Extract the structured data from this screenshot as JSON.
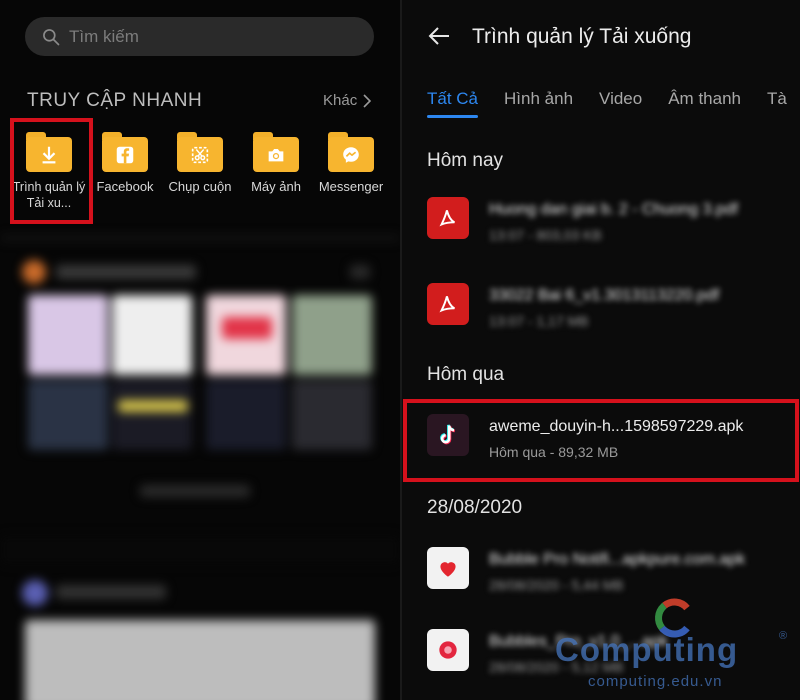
{
  "left": {
    "search": {
      "placeholder": "Tìm kiếm",
      "icon": "search-icon"
    },
    "quick_access": {
      "title": "TRUY CẬP NHANH",
      "more_label": "Khác",
      "items": [
        {
          "label": "Trình quản lý Tải xu...",
          "icon": "download-icon",
          "highlighted": true
        },
        {
          "label": "Facebook",
          "icon": "facebook-icon"
        },
        {
          "label": "Chụp cuộn",
          "icon": "scroll-screenshot-icon"
        },
        {
          "label": "Máy ảnh",
          "icon": "camera-icon"
        },
        {
          "label": "Messenger",
          "icon": "messenger-icon"
        }
      ],
      "folder_color": "#f7b52f"
    }
  },
  "right": {
    "title": "Trình quản lý Tải xuống",
    "tabs": [
      {
        "label": "Tất Cả",
        "active": true
      },
      {
        "label": "Hình ảnh"
      },
      {
        "label": "Video"
      },
      {
        "label": "Âm thanh"
      },
      {
        "label": "Tà"
      }
    ],
    "sections": [
      {
        "title": "Hôm nay",
        "files": [
          {
            "name": "Huong dan giai b. 2 - Chuong 3.pdf",
            "meta": "13:07 - 803,03 KB",
            "icon": "pdf-icon",
            "blurred": true
          },
          {
            "name": "33022 Bai 6_v1.3013113220.pdf",
            "meta": "13:07 - 1,17 MB",
            "icon": "pdf-icon",
            "blurred": true
          }
        ]
      },
      {
        "title": "Hôm qua",
        "files": [
          {
            "name": "aweme_douyin-h...1598597229.apk",
            "meta": "Hôm qua - 89,32 MB",
            "icon": "tiktok-icon",
            "highlighted": true
          }
        ]
      },
      {
        "title": "28/08/2020",
        "files": [
          {
            "name": "Bubble Pro Notifi...apkpure.com.apk",
            "meta": "28/08/2020 - 5,44 MB",
            "icon": "app-icon",
            "blurred": true
          },
          {
            "name": "Bubbles_Pro_v1.0_...apk",
            "meta": "28/08/2020 - 5,12 MB",
            "icon": "app-icon",
            "blurred": true
          }
        ]
      }
    ],
    "accent_color": "#2d87f0",
    "highlight_color": "#d5111c"
  },
  "watermark": {
    "brand": "Computing",
    "url": "computing.edu.vn",
    "reg": "®"
  }
}
